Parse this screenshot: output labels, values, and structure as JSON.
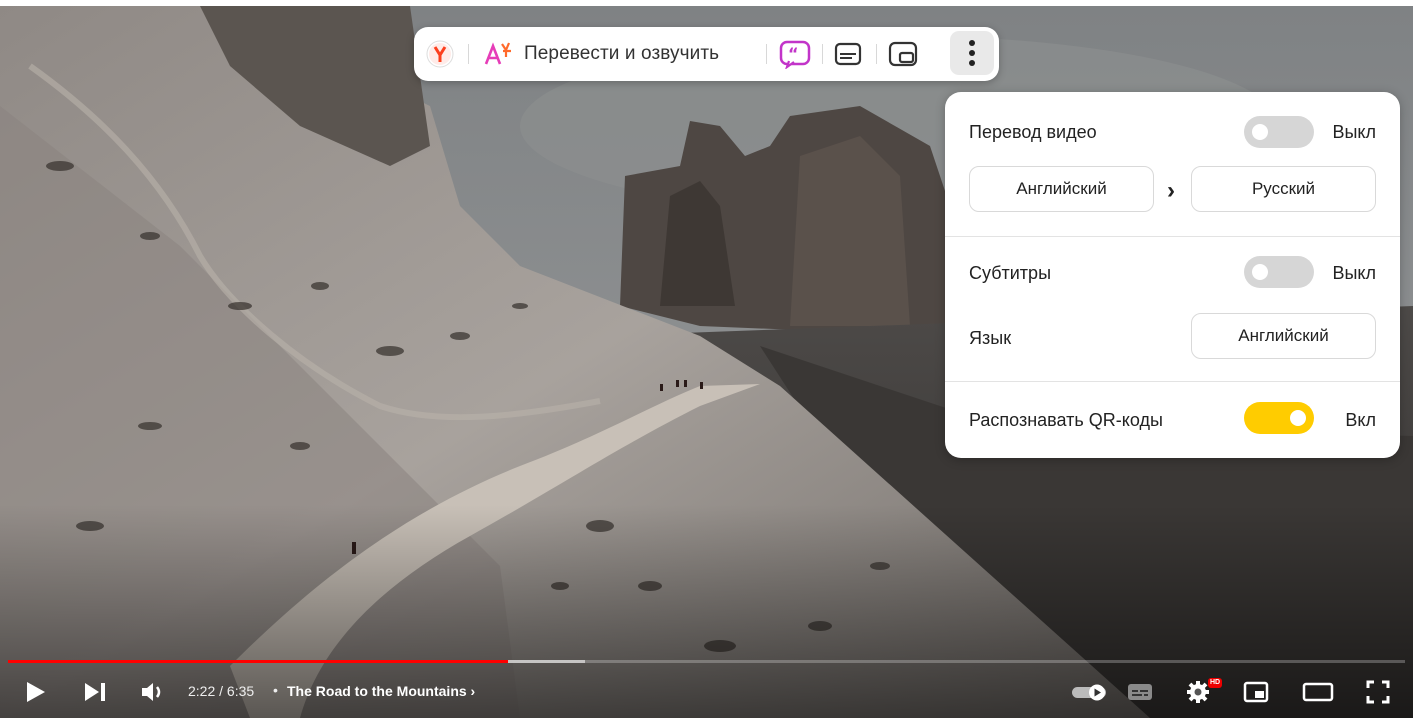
{
  "toolbar": {
    "translate_label": "Перевести и озвучить"
  },
  "panel": {
    "video_translation": {
      "label": "Перевод видео",
      "state": "Выкл",
      "on": false
    },
    "source_language": "Английский",
    "target_language": "Русский",
    "subtitles": {
      "label": "Субтитры",
      "state": "Выкл",
      "on": false
    },
    "subtitles_language": {
      "label": "Язык",
      "value": "Английский"
    },
    "qr_codes": {
      "label": "Распознавать QR-коды",
      "state": "Вкл",
      "on": true
    }
  },
  "player": {
    "time": "2:22 / 6:35",
    "separator": "•",
    "video_title": "The Road to the Mountains",
    "progress": 0.358,
    "buffered": 0.413,
    "hd_badge": "HD"
  },
  "colors": {
    "accent_yellow": "#ffcc00",
    "progress_red": "#ff0000",
    "subtitle_icon_pink": "#c234c9"
  }
}
